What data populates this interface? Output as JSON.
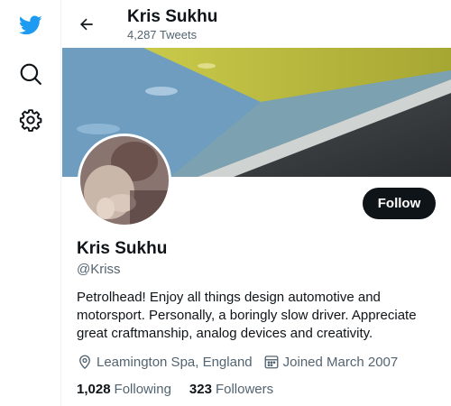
{
  "header": {
    "title": "Kris Sukhu",
    "tweet_count": "4,287 Tweets"
  },
  "nav": {
    "items": [
      "twitter-logo",
      "search-icon",
      "settings-icon"
    ]
  },
  "profile": {
    "name": "Kris Sukhu",
    "handle": "@Kriss",
    "bio": "Petrolhead! Enjoy all things design automotive and motorsport. Personally, a boringly slow driver. Appreciate great craftmanship, analog devices and creativity.",
    "location": "Leamington Spa, England",
    "joined": "Joined March 2007",
    "following_count": "1,028",
    "following_label": "Following",
    "followers_count": "323",
    "followers_label": "Followers",
    "follow_button": "Follow"
  },
  "colors": {
    "brand": "#1d9bf0",
    "text": "#0f1419",
    "secondary": "#536471",
    "button": "#0f1419"
  }
}
